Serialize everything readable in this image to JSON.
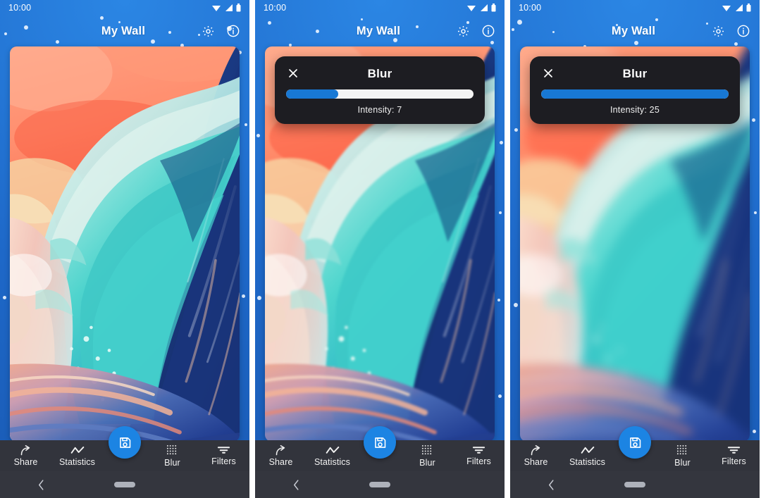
{
  "app": {
    "title": "My Wall",
    "accent_blue": "#1c84e3",
    "backdrop_blue": "#1e68c8",
    "nav_bar_color": "#32343c",
    "dialog_bg": "#1d1d22"
  },
  "status_bar": {
    "time": "10:00",
    "icons": [
      "wifi-icon",
      "signal-icon",
      "battery-icon"
    ]
  },
  "header": {
    "title": "My Wall",
    "settings_icon": "gear-icon",
    "info_icon": "info-circle-icon"
  },
  "wallpaper": {
    "name": "ocean-wave-painting",
    "description": "Painted ocean wave with coral sky and teal barrel"
  },
  "bottom_nav": {
    "items": [
      {
        "label": "Share",
        "icon": "share-icon"
      },
      {
        "label": "Statistics",
        "icon": "chart-line-icon"
      },
      {
        "label": "Blur",
        "icon": "dot-grid-icon"
      },
      {
        "label": "Filters",
        "icon": "filter-icon"
      }
    ],
    "fab": {
      "icon": "save-icon",
      "label": "Save"
    }
  },
  "system_bar": {
    "back_icon": "chevron-left-icon",
    "home_icon": "home-pill-icon"
  },
  "panels": [
    {
      "id": "panel-original",
      "dialog_visible": false,
      "blur_level": 0
    },
    {
      "id": "panel-blur-low",
      "dialog_visible": true,
      "blur_level": 1,
      "dialog": {
        "title": "Blur",
        "close_icon": "close-icon",
        "value_label": "Intensity: 7",
        "value": 7,
        "min": 0,
        "max": 25,
        "fill_percent": 28
      }
    },
    {
      "id": "panel-blur-high",
      "dialog_visible": true,
      "blur_level": 2,
      "dialog": {
        "title": "Blur",
        "close_icon": "close-icon",
        "value_label": "Intensity: 25",
        "value": 25,
        "min": 0,
        "max": 25,
        "fill_percent": 100
      }
    }
  ]
}
